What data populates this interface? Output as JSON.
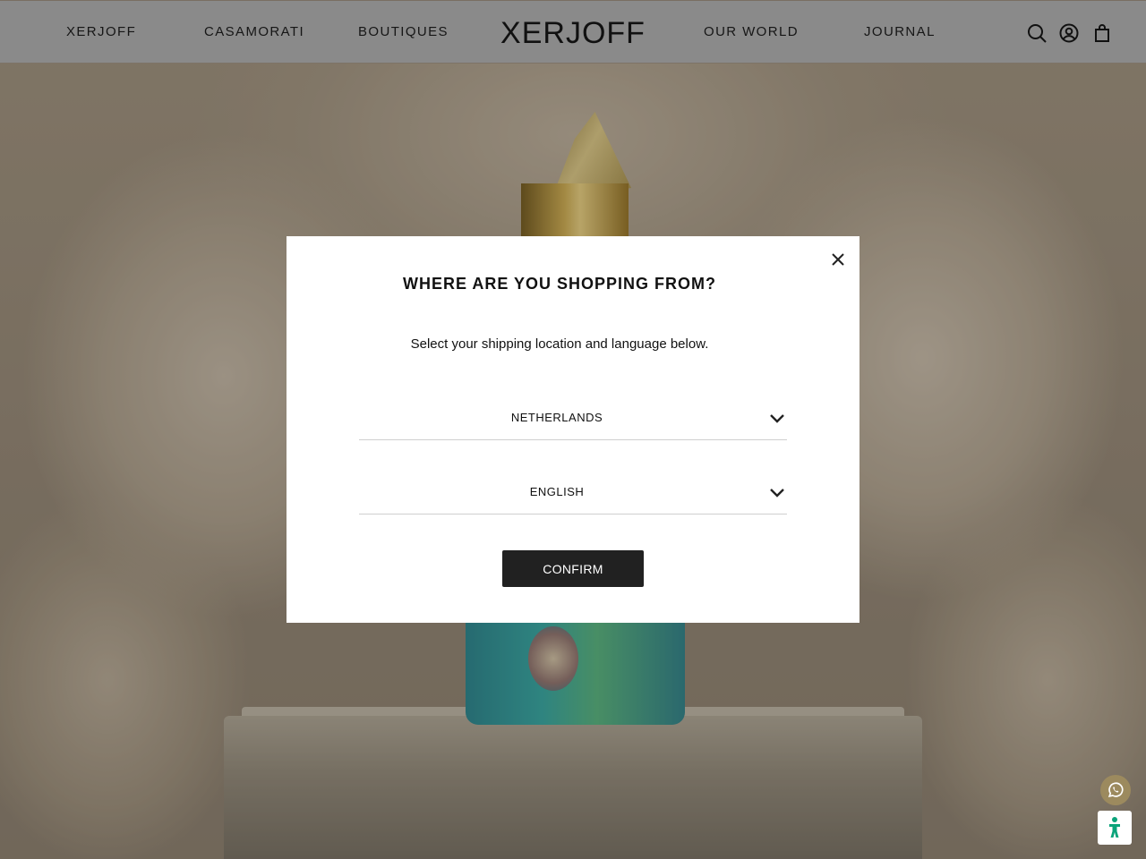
{
  "header": {
    "nav_left": [
      "XERJOFF",
      "CASAMORATI",
      "BOUTIQUES"
    ],
    "logo_text": "XERJOFF",
    "nav_right": [
      "OUR WORLD",
      "JOURNAL"
    ],
    "icons": [
      "search-icon",
      "account-icon",
      "cart-icon"
    ]
  },
  "modal": {
    "title": "WHERE ARE YOU SHOPPING FROM?",
    "subtitle": "Select your shipping location and language below.",
    "country_value": "NETHERLANDS",
    "language_value": "ENGLISH",
    "confirm_label": "CONFIRM",
    "close_icon": "close-icon"
  },
  "floating": {
    "whatsapp_icon": "whatsapp-icon",
    "accessibility_icon": "accessibility-icon",
    "whatsapp_color": "#9c8a5e",
    "accessibility_color": "#0aa37a"
  },
  "colors": {
    "header_bg": "#8a8a8a",
    "button_bg": "#212121",
    "modal_bg": "#ffffff"
  }
}
